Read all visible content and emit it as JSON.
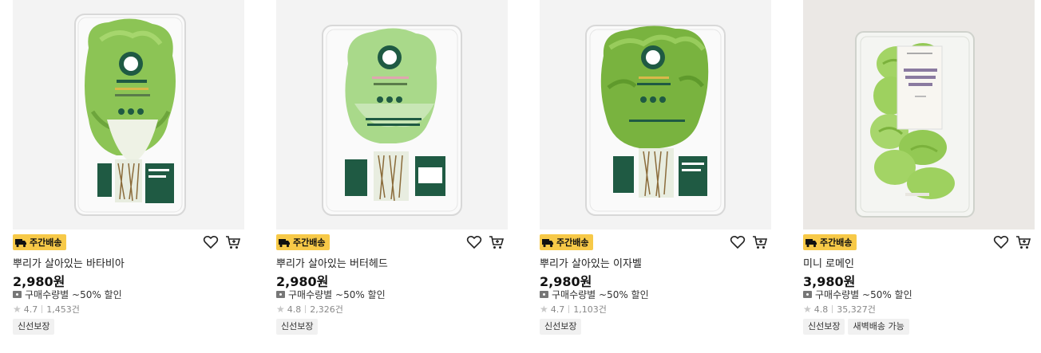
{
  "products": [
    {
      "image_icon": "lettuce-package-image",
      "badge": "주간배송",
      "name": "뿌리가 살아있는 바타비아",
      "price": "2,980원",
      "discount": "구매수량별 ~50% 할인",
      "rating": "4.7",
      "reviews": "1,453건",
      "tags": [
        "신선보장"
      ]
    },
    {
      "image_icon": "lettuce-package-image",
      "badge": "주간배송",
      "name": "뿌리가 살아있는 버터헤드",
      "price": "2,980원",
      "discount": "구매수량별 ~50% 할인",
      "rating": "4.8",
      "reviews": "2,326건",
      "tags": [
        "신선보장"
      ]
    },
    {
      "image_icon": "lettuce-package-image",
      "badge": "주간배송",
      "name": "뿌리가 살아있는 이자벨",
      "price": "2,980원",
      "discount": "구매수량별 ~50% 할인",
      "rating": "4.7",
      "reviews": "1,103건",
      "tags": [
        "신선보장"
      ]
    },
    {
      "image_icon": "romaine-package-image",
      "badge": "주간배송",
      "name": "미니 로메인",
      "price": "3,980원",
      "discount": "구매수량별 ~50% 할인",
      "rating": "4.8",
      "reviews": "35,327건",
      "tags": [
        "신선보장",
        "새벽배송 가능"
      ]
    }
  ],
  "colors": {
    "badge_bg": "#f7c948",
    "tag_bg": "#f1f1f1",
    "lettuce_green": "#8cc455",
    "label_green": "#1f5a43"
  }
}
